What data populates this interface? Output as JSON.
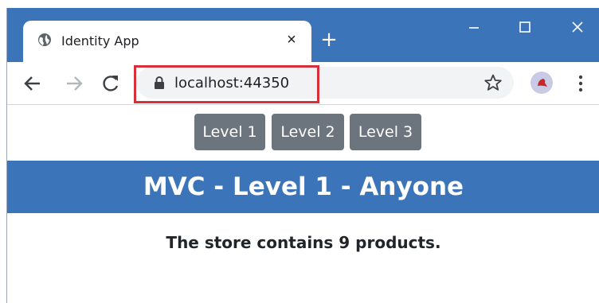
{
  "browser": {
    "tab_title": "Identity App",
    "tab_close_label": "×",
    "new_tab_label": "+",
    "url": "localhost:44350",
    "colors": {
      "frame": "#3b74b9",
      "url_highlight": "#d6303a"
    },
    "icons": {
      "favicon": "globe-icon",
      "back": "back-arrow-icon",
      "forward": "forward-arrow-icon",
      "reload": "reload-icon",
      "lock": "lock-icon",
      "bookmark": "star-icon",
      "profile": "profile-avatar-icon",
      "menu": "kebab-menu-icon",
      "minimize": "minimize-icon",
      "maximize": "maximize-icon",
      "close": "close-icon"
    }
  },
  "page": {
    "nav_buttons": [
      {
        "label": "Level 1"
      },
      {
        "label": "Level 2"
      },
      {
        "label": "Level 3"
      }
    ],
    "banner_title": "MVC - Level 1 - Anyone",
    "store_message": "The store contains 9 products.",
    "colors": {
      "button_bg": "#6c757d",
      "banner_bg": "#3b74b9"
    }
  }
}
